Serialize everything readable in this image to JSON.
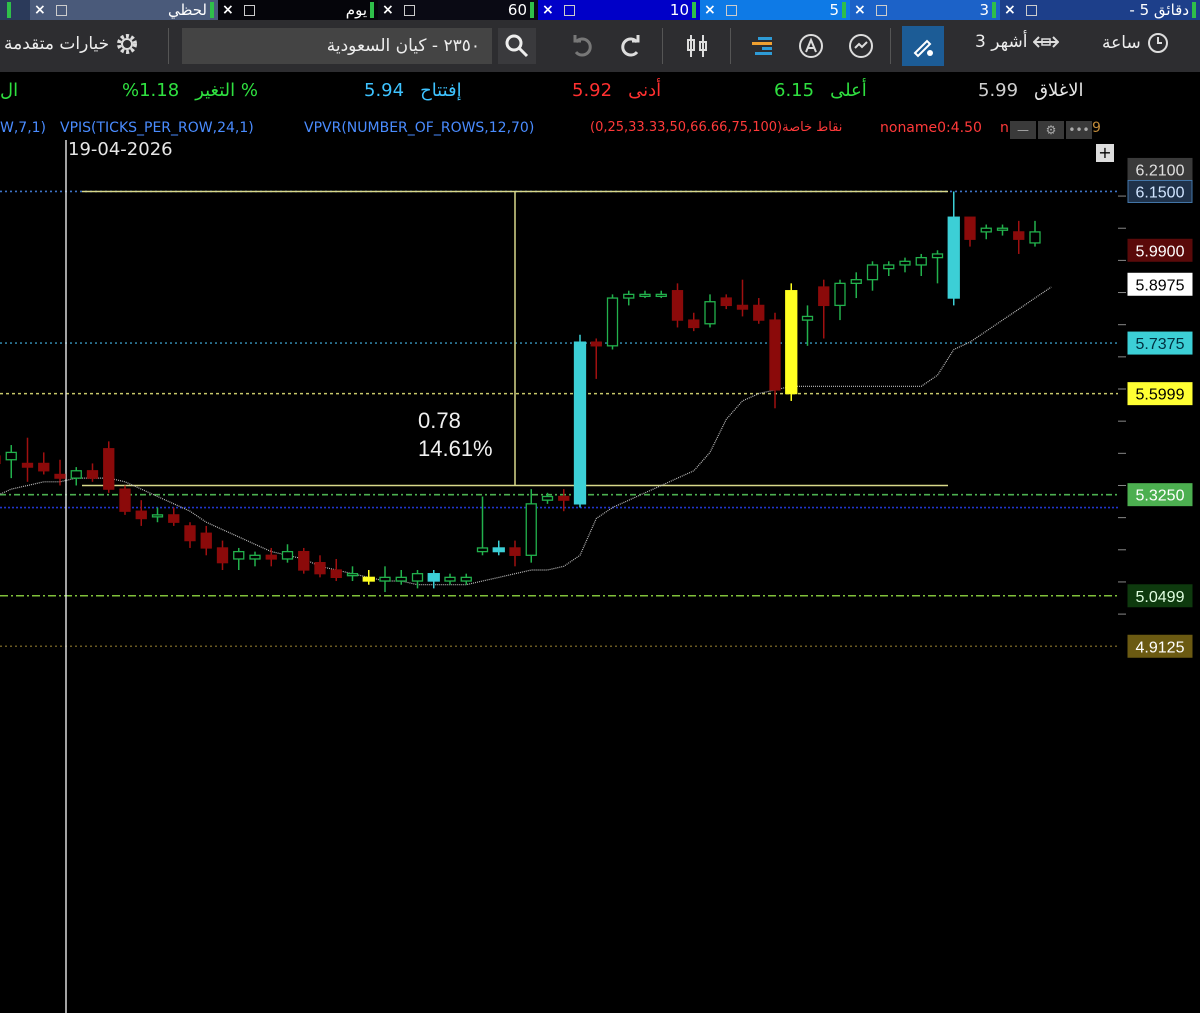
{
  "tabs": [
    {
      "label": "- 5 دقائق",
      "bg": "#1d3f8a",
      "active": false
    },
    {
      "label": "3",
      "bg": "#1c62c8",
      "active": false
    },
    {
      "label": "5",
      "bg": "#0e7ae6",
      "active": false
    },
    {
      "label": "10",
      "bg": "#0000c8",
      "active": false
    },
    {
      "label": "60",
      "bg": "#0a0a14",
      "active": false
    },
    {
      "label": "يوم",
      "bg": "#05050a",
      "active": true
    },
    {
      "label": "لحظي",
      "bg": "#4a5a7a",
      "active": false
    },
    {
      "label": "",
      "bg": "#2b3a5a",
      "active": false
    }
  ],
  "toolbar": {
    "interval_label": "ساعة",
    "range_label": "3 أشهر",
    "search_value": "٢٣٥٠ - كيان السعودية",
    "advanced_label": "خيارات متقدمة"
  },
  "quote": {
    "close_label": "الاغلاق",
    "close_value": "5.99",
    "high_label": "أعلى",
    "high_value": "6.15",
    "low_label": "أدنى",
    "low_value": "5.92",
    "open_label": "إفتتاح",
    "open_value": "5.94",
    "change_label": "التغير %",
    "change_value": "%1.18",
    "extra_label": "ال"
  },
  "indicators": {
    "i1": "W,7,1)",
    "i2": "VPIS(TICKS_PER_ROW,24,1)",
    "i3": "VPVR(NUMBER_OF_ROWS,12,70)",
    "i4": "(0,25,33.33,50,66.66,75,100)نقاط خاصة",
    "i5": "noname0:4.50",
    "i6": "n",
    "i7": "9"
  },
  "date_label": "19-04-2026",
  "chart_data": {
    "type": "candlestick",
    "ylim": [
      4.85,
      6.27
    ],
    "price_tags": [
      {
        "value": "6.2100",
        "num": 6.21,
        "bg": "#3a3a3a",
        "fg": "#e0e0e0",
        "border": "#3a3a3a"
      },
      {
        "value": "6.1500",
        "num": 6.15,
        "bg": "#20324a",
        "fg": "#d0e4ff",
        "border": "#4477aa"
      },
      {
        "value": "5.9900",
        "num": 5.99,
        "bg": "#5a0a0a",
        "fg": "#ffffff",
        "border": "#5a0a0a"
      },
      {
        "value": "5.8975",
        "num": 5.8975,
        "bg": "#ffffff",
        "fg": "#000000",
        "border": "#ffffff"
      },
      {
        "value": "5.7375",
        "num": 5.7375,
        "bg": "#3ccfd6",
        "fg": "#003040",
        "border": "#3ccfd6"
      },
      {
        "value": "5.5999",
        "num": 5.5999,
        "bg": "#ffff33",
        "fg": "#000000",
        "border": "#ffff33"
      },
      {
        "value": "5.3250",
        "num": 5.325,
        "bg": "#4caf50",
        "fg": "#ffffff",
        "border": "#4caf50"
      },
      {
        "value": "5.0499",
        "num": 5.0499,
        "bg": "#0e3a0e",
        "fg": "#e0ffe0",
        "border": "#0e3a0e"
      },
      {
        "value": "4.9125",
        "num": 4.9125,
        "bg": "#6b5a12",
        "fg": "#ffffff",
        "border": "#6b5a12"
      }
    ],
    "hlines": [
      {
        "y": 6.15,
        "color": "#3f74c8",
        "dash": "2,3"
      },
      {
        "y": 5.7375,
        "color": "#2f7fa0",
        "dash": "2,3"
      },
      {
        "y": 5.5999,
        "color": "#c8c86a",
        "dash": "3,3"
      },
      {
        "y": 5.325,
        "color": "#4caf50",
        "dash": "6,3,2,3"
      },
      {
        "y": 5.29,
        "color": "#2235cc",
        "dash": "2,2"
      },
      {
        "y": 5.0499,
        "color": "#7fbf3a",
        "dash": "8,3,2,3"
      },
      {
        "y": 4.9125,
        "color": "#6a5a22",
        "dash": "2,3"
      }
    ],
    "measure": {
      "value_text": "0.78",
      "percent_text": "14.61%",
      "top": 6.15,
      "bottom": 5.35
    },
    "candles": [
      {
        "o": 5.43,
        "h": 5.46,
        "l": 5.39,
        "c": 5.41,
        "col": "down"
      },
      {
        "o": 5.42,
        "h": 5.46,
        "l": 5.37,
        "c": 5.44,
        "col": "up"
      },
      {
        "o": 5.41,
        "h": 5.48,
        "l": 5.36,
        "c": 5.4,
        "col": "down"
      },
      {
        "o": 5.41,
        "h": 5.44,
        "l": 5.38,
        "c": 5.39,
        "col": "down"
      },
      {
        "o": 5.38,
        "h": 5.42,
        "l": 5.35,
        "c": 5.37,
        "col": "down"
      },
      {
        "o": 5.37,
        "h": 5.4,
        "l": 5.35,
        "c": 5.39,
        "col": "up"
      },
      {
        "o": 5.39,
        "h": 5.41,
        "l": 5.36,
        "c": 5.37,
        "col": "down"
      },
      {
        "o": 5.45,
        "h": 5.47,
        "l": 5.33,
        "c": 5.34,
        "col": "down"
      },
      {
        "o": 5.34,
        "h": 5.35,
        "l": 5.27,
        "c": 5.28,
        "col": "down"
      },
      {
        "o": 5.28,
        "h": 5.31,
        "l": 5.24,
        "c": 5.26,
        "col": "down"
      },
      {
        "o": 5.27,
        "h": 5.29,
        "l": 5.25,
        "c": 5.27,
        "col": "up"
      },
      {
        "o": 5.27,
        "h": 5.29,
        "l": 5.24,
        "c": 5.25,
        "col": "down"
      },
      {
        "o": 5.24,
        "h": 5.25,
        "l": 5.18,
        "c": 5.2,
        "col": "down"
      },
      {
        "o": 5.22,
        "h": 5.24,
        "l": 5.16,
        "c": 5.18,
        "col": "down"
      },
      {
        "o": 5.18,
        "h": 5.2,
        "l": 5.12,
        "c": 5.14,
        "col": "down"
      },
      {
        "o": 5.15,
        "h": 5.18,
        "l": 5.12,
        "c": 5.17,
        "col": "up"
      },
      {
        "o": 5.15,
        "h": 5.17,
        "l": 5.13,
        "c": 5.16,
        "col": "up"
      },
      {
        "o": 5.16,
        "h": 5.18,
        "l": 5.13,
        "c": 5.15,
        "col": "down"
      },
      {
        "o": 5.15,
        "h": 5.19,
        "l": 5.14,
        "c": 5.17,
        "col": "up"
      },
      {
        "o": 5.17,
        "h": 5.18,
        "l": 5.11,
        "c": 5.12,
        "col": "down"
      },
      {
        "o": 5.14,
        "h": 5.16,
        "l": 5.1,
        "c": 5.11,
        "col": "down"
      },
      {
        "o": 5.12,
        "h": 5.15,
        "l": 5.09,
        "c": 5.1,
        "col": "down"
      },
      {
        "o": 5.11,
        "h": 5.13,
        "l": 5.09,
        "c": 5.11,
        "col": "up"
      },
      {
        "o": 5.1,
        "h": 5.12,
        "l": 5.08,
        "c": 5.09,
        "col": "yellow"
      },
      {
        "o": 5.09,
        "h": 5.13,
        "l": 5.06,
        "c": 5.1,
        "col": "up"
      },
      {
        "o": 5.1,
        "h": 5.12,
        "l": 5.08,
        "c": 5.09,
        "col": "up"
      },
      {
        "o": 5.09,
        "h": 5.12,
        "l": 5.07,
        "c": 5.11,
        "col": "up"
      },
      {
        "o": 5.09,
        "h": 5.12,
        "l": 5.07,
        "c": 5.11,
        "col": "cyan"
      },
      {
        "o": 5.1,
        "h": 5.11,
        "l": 5.08,
        "c": 5.09,
        "col": "up"
      },
      {
        "o": 5.09,
        "h": 5.11,
        "l": 5.08,
        "c": 5.1,
        "col": "up"
      },
      {
        "o": 5.17,
        "h": 5.32,
        "l": 5.16,
        "c": 5.18,
        "col": "up"
      },
      {
        "o": 5.18,
        "h": 5.2,
        "l": 5.16,
        "c": 5.17,
        "col": "cyan"
      },
      {
        "o": 5.18,
        "h": 5.2,
        "l": 5.13,
        "c": 5.16,
        "col": "down"
      },
      {
        "o": 5.16,
        "h": 5.34,
        "l": 5.14,
        "c": 5.3,
        "col": "up"
      },
      {
        "o": 5.31,
        "h": 5.33,
        "l": 5.3,
        "c": 5.32,
        "col": "up"
      },
      {
        "o": 5.32,
        "h": 5.34,
        "l": 5.28,
        "c": 5.31,
        "col": "down"
      },
      {
        "o": 5.3,
        "h": 5.76,
        "l": 5.29,
        "c": 5.74,
        "col": "cyan"
      },
      {
        "o": 5.74,
        "h": 5.75,
        "l": 5.64,
        "c": 5.73,
        "col": "down"
      },
      {
        "o": 5.73,
        "h": 5.87,
        "l": 5.72,
        "c": 5.86,
        "col": "up"
      },
      {
        "o": 5.86,
        "h": 5.88,
        "l": 5.84,
        "c": 5.87,
        "col": "up"
      },
      {
        "o": 5.87,
        "h": 5.88,
        "l": 5.86,
        "c": 5.87,
        "col": "up"
      },
      {
        "o": 5.87,
        "h": 5.88,
        "l": 5.86,
        "c": 5.87,
        "col": "up"
      },
      {
        "o": 5.88,
        "h": 5.9,
        "l": 5.78,
        "c": 5.8,
        "col": "down"
      },
      {
        "o": 5.8,
        "h": 5.82,
        "l": 5.77,
        "c": 5.78,
        "col": "down"
      },
      {
        "o": 5.79,
        "h": 5.87,
        "l": 5.78,
        "c": 5.85,
        "col": "up"
      },
      {
        "o": 5.86,
        "h": 5.87,
        "l": 5.83,
        "c": 5.84,
        "col": "down"
      },
      {
        "o": 5.84,
        "h": 5.91,
        "l": 5.81,
        "c": 5.83,
        "col": "down"
      },
      {
        "o": 5.84,
        "h": 5.86,
        "l": 5.79,
        "c": 5.8,
        "col": "down"
      },
      {
        "o": 5.8,
        "h": 5.82,
        "l": 5.56,
        "c": 5.61,
        "col": "down"
      },
      {
        "o": 5.6,
        "h": 5.9,
        "l": 5.58,
        "c": 5.88,
        "col": "yellow"
      },
      {
        "o": 5.8,
        "h": 5.84,
        "l": 5.73,
        "c": 5.81,
        "col": "up"
      },
      {
        "o": 5.89,
        "h": 5.91,
        "l": 5.75,
        "c": 5.84,
        "col": "down"
      },
      {
        "o": 5.84,
        "h": 5.91,
        "l": 5.8,
        "c": 5.9,
        "col": "up"
      },
      {
        "o": 5.9,
        "h": 5.93,
        "l": 5.86,
        "c": 5.91,
        "col": "up"
      },
      {
        "o": 5.91,
        "h": 5.96,
        "l": 5.88,
        "c": 5.95,
        "col": "up"
      },
      {
        "o": 5.94,
        "h": 5.96,
        "l": 5.92,
        "c": 5.95,
        "col": "up"
      },
      {
        "o": 5.95,
        "h": 5.97,
        "l": 5.93,
        "c": 5.96,
        "col": "up"
      },
      {
        "o": 5.95,
        "h": 5.98,
        "l": 5.92,
        "c": 5.97,
        "col": "up"
      },
      {
        "o": 5.97,
        "h": 5.99,
        "l": 5.9,
        "c": 5.98,
        "col": "up"
      },
      {
        "o": 5.86,
        "h": 6.15,
        "l": 5.84,
        "c": 6.08,
        "col": "cyan"
      },
      {
        "o": 6.08,
        "h": 6.08,
        "l": 6.0,
        "c": 6.02,
        "col": "down"
      },
      {
        "o": 6.04,
        "h": 6.06,
        "l": 6.02,
        "c": 6.05,
        "col": "up"
      },
      {
        "o": 6.05,
        "h": 6.06,
        "l": 6.03,
        "c": 6.05,
        "col": "up"
      },
      {
        "o": 6.04,
        "h": 6.07,
        "l": 5.98,
        "c": 6.02,
        "col": "down"
      },
      {
        "o": 6.01,
        "h": 6.07,
        "l": 6.0,
        "c": 6.04,
        "col": "up"
      }
    ],
    "trail": [
      5.32,
      5.34,
      5.35,
      5.36,
      5.36,
      5.37,
      5.37,
      5.37,
      5.36,
      5.34,
      5.32,
      5.3,
      5.28,
      5.25,
      5.23,
      5.21,
      5.19,
      5.17,
      5.16,
      5.15,
      5.13,
      5.12,
      5.11,
      5.1,
      5.09,
      5.09,
      5.08,
      5.08,
      5.08,
      5.08,
      5.09,
      5.1,
      5.11,
      5.12,
      5.12,
      5.13,
      5.16,
      5.26,
      5.29,
      5.31,
      5.33,
      5.35,
      5.37,
      5.39,
      5.44,
      5.53,
      5.58,
      5.6,
      5.61,
      5.62,
      5.62,
      5.62,
      5.62,
      5.62,
      5.62,
      5.62,
      5.62,
      5.62,
      5.65,
      5.72,
      5.74,
      5.77,
      5.8,
      5.83,
      5.86,
      5.89
    ]
  }
}
